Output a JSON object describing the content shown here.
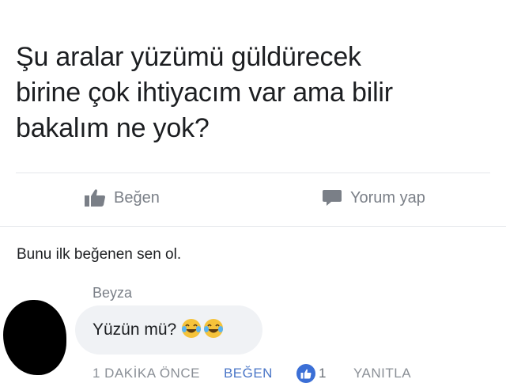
{
  "post": {
    "text": "Şu aralar yüzümü güldürecek\nbirine çok ihtiyacım var ama bilir\nbakalım ne yok?"
  },
  "actions": {
    "like_label": "Beğen",
    "comment_label": "Yorum yap"
  },
  "likes_summary": "Bunu ilk beğenen sen ol.",
  "comment": {
    "author": "Beyza",
    "text": "Yüzün mü?",
    "emoji": [
      "face-with-tears-of-joy",
      "face-with-tears-of-joy"
    ],
    "time": "1 DAKİKA ÖNCE",
    "like_link": "BEĞEN",
    "like_count": "1",
    "reply_link": "YANITLA"
  },
  "colors": {
    "link_blue": "#4a76c7",
    "badge_blue": "#3b6fd6",
    "bubble_bg": "#f0f2f5",
    "muted_text": "#7a7f87"
  }
}
